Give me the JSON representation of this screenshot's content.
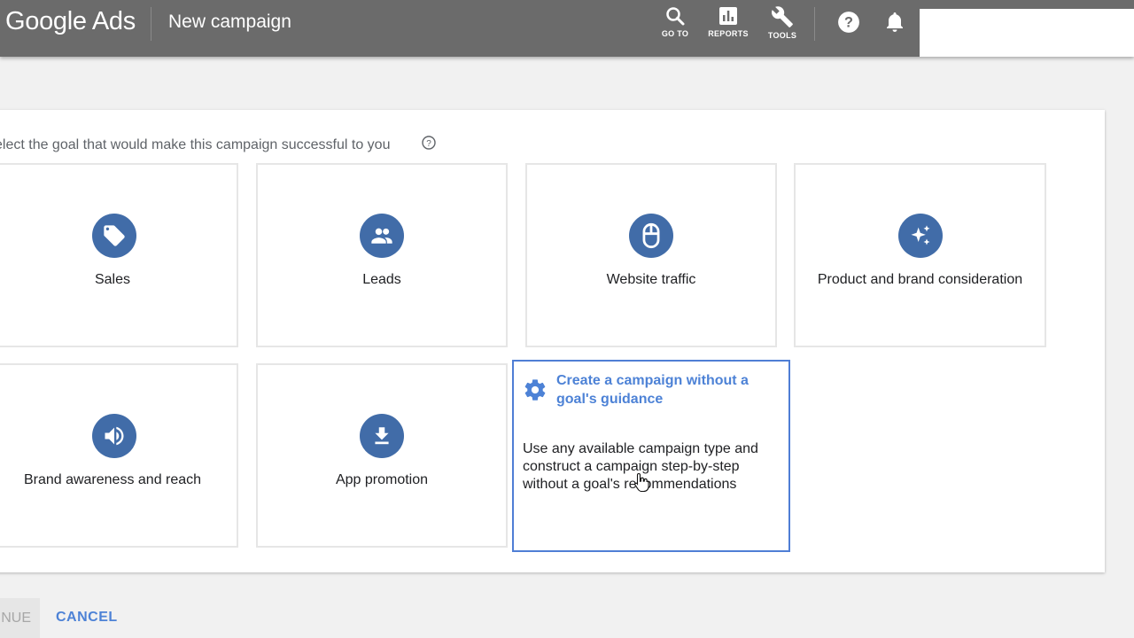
{
  "header": {
    "logo": "Google Ads",
    "page_title": "New campaign",
    "tools": [
      {
        "label": "GO TO",
        "icon": "search-icon"
      },
      {
        "label": "REPORTS",
        "icon": "reports-icon"
      },
      {
        "label": "TOOLS",
        "icon": "wrench-icon"
      }
    ],
    "icons": [
      "help-icon",
      "bell-icon"
    ]
  },
  "main": {
    "prompt": "elect the goal that would make this campaign successful to you",
    "goals": [
      {
        "title": "Sales",
        "icon": "tag-icon"
      },
      {
        "title": "Leads",
        "icon": "people-icon"
      },
      {
        "title": "Website traffic",
        "icon": "mouse-icon"
      },
      {
        "title": "Product and brand consideration",
        "icon": "sparkle-icon"
      },
      {
        "title": "Brand awareness and reach",
        "icon": "speaker-icon"
      },
      {
        "title": "App promotion",
        "icon": "download-icon"
      }
    ],
    "no_goal": {
      "title": "Create a campaign without a goal's guidance",
      "description": "Use any available campaign type and construct a campaign step-by-step without a goal's recommendations",
      "icon": "gear-icon",
      "selected": true
    }
  },
  "footer": {
    "continue_label": "NUE",
    "cancel_label": "CANCEL"
  },
  "colors": {
    "header_bg": "#6b6b6b",
    "icon_circle": "#416ca8",
    "accent_blue": "#4d82d6",
    "selected_border": "#4f7ed5"
  }
}
